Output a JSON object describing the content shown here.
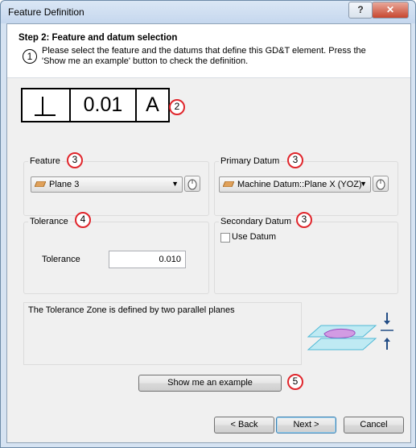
{
  "window": {
    "title": "Feature Definition",
    "help_label": "?",
    "close_label": "✕"
  },
  "header": {
    "step_title": "Step 2: Feature and datum selection",
    "instruction": "Please select the feature and the datums that define this GD&T element. Press the 'Show me an example' button to check the definition.",
    "badge": "1"
  },
  "fcf": {
    "symbol": "⊥",
    "tolerance": "0.01",
    "datum": "A",
    "badge": "2"
  },
  "feature": {
    "label": "Feature",
    "badge": "3",
    "selected": "Plane 3"
  },
  "primary_datum": {
    "label": "Primary Datum",
    "badge": "3",
    "selected": "Machine Datum::Plane X (YOZ)"
  },
  "tolerance_group": {
    "label": "Tolerance",
    "badge": "4",
    "field_label": "Tolerance",
    "value": "0.010"
  },
  "secondary_datum": {
    "label": "Secondary Datum",
    "badge": "3",
    "checkbox_label": "Use Datum",
    "checked": false
  },
  "info": {
    "text": "The Tolerance Zone is defined by two parallel planes"
  },
  "example": {
    "label": "Show me an example",
    "badge": "5"
  },
  "footer": {
    "back": "< Back",
    "next": "Next >",
    "cancel": "Cancel"
  },
  "colors": {
    "accent_badge": "#e0262c",
    "plane": "#7fd3e6",
    "zone": "#c58de0"
  }
}
